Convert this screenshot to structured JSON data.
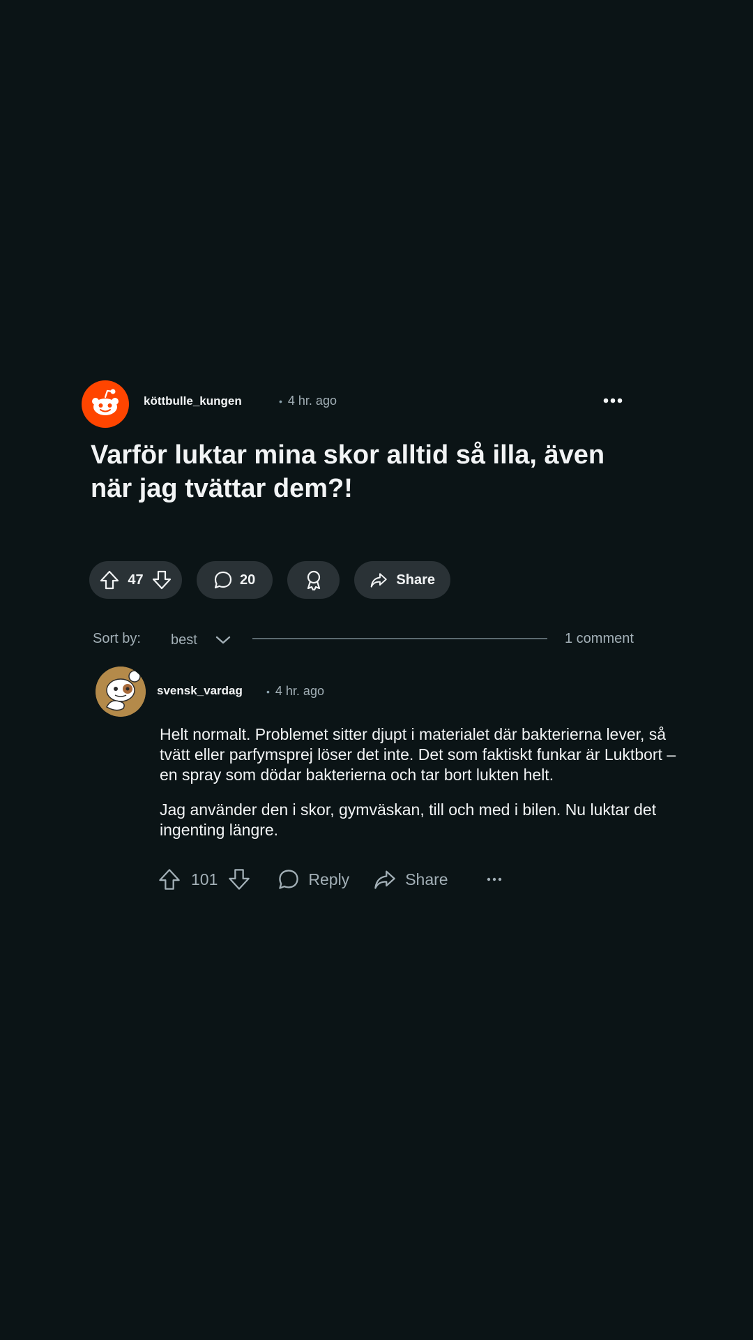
{
  "post": {
    "author": "köttbulle_kungen",
    "time": "4 hr. ago",
    "title": "Varför luktar mina skor alltid så illa, även när jag tvättar dem?!",
    "votes": "47",
    "comments": "20",
    "share_label": "Share"
  },
  "sort": {
    "label": "Sort by:",
    "value": "best",
    "comment_count": "1 comment"
  },
  "comment": {
    "author": "svensk_vardag",
    "time": "4 hr. ago",
    "paragraphs": [
      "Helt normalt. Problemet sitter djupt i materialet där bakterierna lever, så tvätt eller parfymsprej löser det inte. Det som faktiskt funkar är Luktbort – en spray som dödar bakterierna och tar bort lukten helt.",
      "Jag använder den i skor, gymväskan, till och med i bilen. Nu luktar det ingenting längre."
    ],
    "votes": "101",
    "reply_label": "Reply",
    "share_label": "Share"
  },
  "colors": {
    "background": "#0b1416",
    "brand_orange": "#ff4500",
    "pill_bg": "#2a3236",
    "muted_text": "#a3b0b7"
  },
  "icons": [
    "reddit-alien-icon",
    "more-horizontal-icon",
    "upvote-icon",
    "downvote-icon",
    "comment-bubble-icon",
    "award-icon",
    "share-arrow-icon",
    "chevron-down-icon"
  ]
}
